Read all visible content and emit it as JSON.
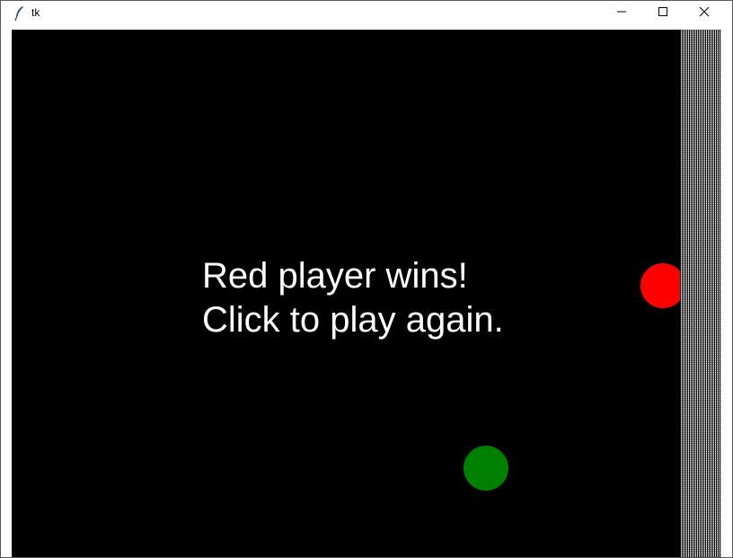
{
  "window": {
    "title": "tk",
    "icon": "feather-icon",
    "controls": {
      "minimize": "minimize-icon",
      "maximize": "maximize-icon",
      "close": "close-icon"
    }
  },
  "game": {
    "background_color": "#000000",
    "message_lines": [
      "Red player wins!",
      "Click to play again."
    ],
    "message_color": "#ffffff",
    "players": [
      {
        "color": "#ff0000"
      },
      {
        "color": "#008000"
      }
    ]
  }
}
